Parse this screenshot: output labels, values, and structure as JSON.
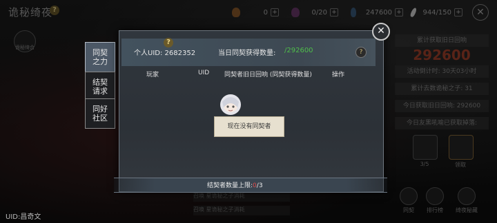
{
  "top": {
    "title": "诡秘绮夜",
    "resources": [
      {
        "icon": "item-icon",
        "value": "0"
      },
      {
        "icon": "potion-icon",
        "value": "0/20"
      },
      {
        "icon": "blade-icon",
        "value": "247600"
      },
      {
        "icon": "feather-icon",
        "value": "944/150"
      }
    ]
  },
  "logo_label": "诡秘绮合",
  "bottom_uid": "UID:昌奇文",
  "tabs": [
    {
      "label": "同契\n之力",
      "active": true
    },
    {
      "label": "结契\n请求",
      "active": false
    },
    {
      "label": "同好\n社区",
      "active": false
    }
  ],
  "modal": {
    "uid_label": "个人UID:",
    "uid_value": "2682352",
    "daily_label": "当日同契获得数量:",
    "daily_value": "/292600",
    "columns": [
      "玩家",
      "UID",
      "同契者旧日回响 (同契获得数量)",
      "操作"
    ],
    "empty_message": "现在没有同契者",
    "limit_label": "结契者数量上限:",
    "limit_current": "0",
    "limit_max": "/3"
  },
  "right_panel": {
    "total_label": "累计获取旧日回响",
    "total_value": "292600",
    "countdown": "活动倒计时: 30天03小时",
    "pull_count": "累计去数诡秘之子: 31",
    "today": "今日获取旧日回响: 292600",
    "rewards": "今日友黑吼喻已获取掉落:",
    "items": [
      {
        "count": "3/5"
      },
      {
        "count": "领取"
      }
    ],
    "nav": [
      "同契",
      "排行榜",
      "绮夜秘藏"
    ]
  },
  "bottom_rows": [
    "召唤  星诡秘之子消耗",
    "召唤  星诡秘之子消耗"
  ],
  "colors": {
    "accent_green": "#4fbf4a",
    "limit_red": "#e04a4a",
    "total_red": "#a0402a"
  }
}
